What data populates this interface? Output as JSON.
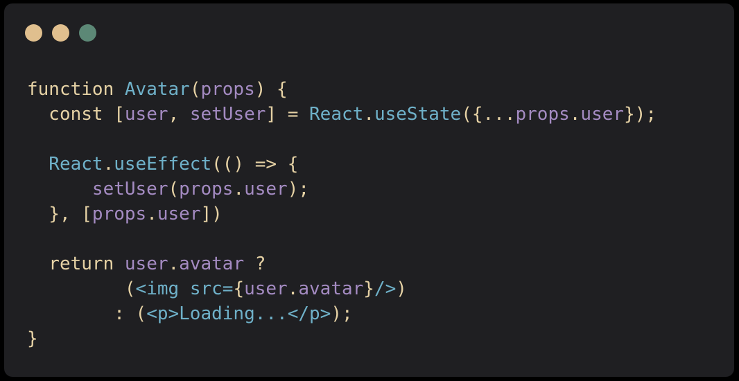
{
  "window": {
    "controls": [
      {
        "name": "close",
        "color": "#e0bf8e"
      },
      {
        "name": "minimize",
        "color": "#e0bf8e"
      },
      {
        "name": "maximize",
        "color": "#5c8876"
      }
    ]
  },
  "code": {
    "lines": [
      [
        [
          "kw",
          "function "
        ],
        [
          "fn",
          "Avatar"
        ],
        [
          "pun",
          "("
        ],
        [
          "var",
          "props"
        ],
        [
          "pun",
          ") {"
        ]
      ],
      [
        [
          "kw",
          "  const "
        ],
        [
          "pun",
          "["
        ],
        [
          "var",
          "user"
        ],
        [
          "pun",
          ", "
        ],
        [
          "var",
          "setUser"
        ],
        [
          "pun",
          "] = "
        ],
        [
          "fn",
          "React"
        ],
        [
          "pun",
          "."
        ],
        [
          "fn",
          "useState"
        ],
        [
          "pun",
          "({"
        ],
        [
          "pun",
          "..."
        ],
        [
          "var",
          "props"
        ],
        [
          "pun",
          "."
        ],
        [
          "var",
          "user"
        ],
        [
          "pun",
          "});"
        ]
      ],
      [],
      [
        [
          "fn",
          "  React"
        ],
        [
          "pun",
          "."
        ],
        [
          "fn",
          "useEffect"
        ],
        [
          "pun",
          "(() => {"
        ]
      ],
      [
        [
          "var",
          "      setUser"
        ],
        [
          "pun",
          "("
        ],
        [
          "var",
          "props"
        ],
        [
          "pun",
          "."
        ],
        [
          "var",
          "user"
        ],
        [
          "pun",
          ");"
        ]
      ],
      [
        [
          "pun",
          "  }, ["
        ],
        [
          "var",
          "props"
        ],
        [
          "pun",
          "."
        ],
        [
          "var",
          "user"
        ],
        [
          "pun",
          "])"
        ]
      ],
      [],
      [
        [
          "kw",
          "  return "
        ],
        [
          "var",
          "user"
        ],
        [
          "pun",
          "."
        ],
        [
          "var",
          "avatar"
        ],
        [
          "pun",
          " ?"
        ]
      ],
      [
        [
          "pun",
          "         ("
        ],
        [
          "tag",
          "<img src="
        ],
        [
          "pun",
          "{"
        ],
        [
          "var",
          "user"
        ],
        [
          "pun",
          "."
        ],
        [
          "var",
          "avatar"
        ],
        [
          "pun",
          "}"
        ],
        [
          "tag",
          "/>"
        ],
        [
          "pun",
          ")"
        ]
      ],
      [
        [
          "pun",
          "        : ("
        ],
        [
          "tag",
          "<p>"
        ],
        [
          "str",
          "Loading..."
        ],
        [
          "tag",
          "</p>"
        ],
        [
          "pun",
          ");"
        ]
      ],
      [
        [
          "pun",
          "}"
        ]
      ]
    ]
  }
}
